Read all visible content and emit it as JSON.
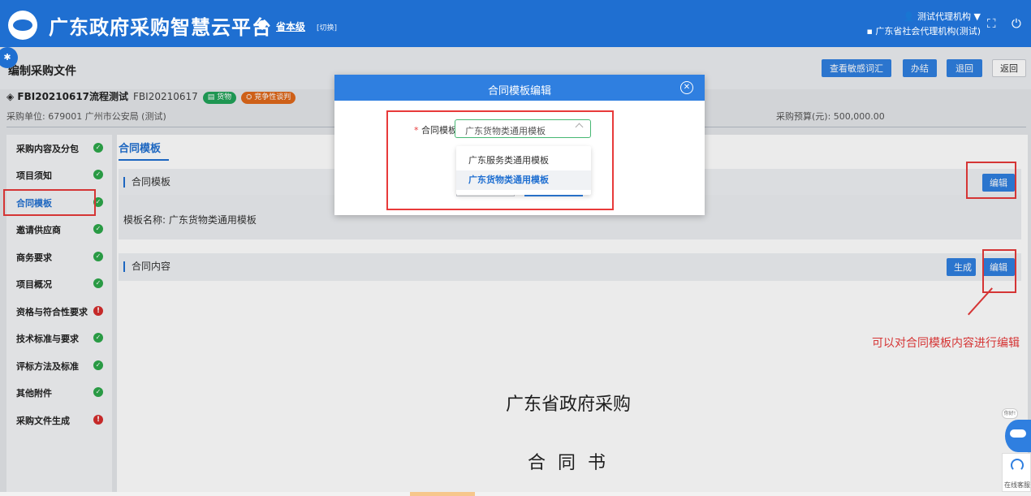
{
  "header": {
    "app_title": "广东政府采购智慧云平台",
    "region": "省本级",
    "switch_label": "[切换]",
    "user_name": "测试代理机构",
    "org_name": "广东省社会代理机构(测试)"
  },
  "toolbar": {
    "page_title": "编制采购文件",
    "sensitive_words": "查看敏感词汇",
    "finish": "办结",
    "return_back": "退回",
    "back": "返回"
  },
  "project": {
    "name": "FBI20210617流程测试",
    "code": "FBI20210617",
    "tag_goods": "▤ 货物",
    "tag_method": "⛭ 竞争性谈判",
    "purchaser": "采购单位: 679001 广州市公安局 (测试)",
    "budget": "采购预算(元): 500,000.00"
  },
  "sidebar": {
    "items": [
      {
        "label": "采购内容及分包",
        "status": "ok"
      },
      {
        "label": "项目须知",
        "status": "ok"
      },
      {
        "label": "合同模板",
        "status": "ok"
      },
      {
        "label": "邀请供应商",
        "status": "ok"
      },
      {
        "label": "商务要求",
        "status": "ok"
      },
      {
        "label": "项目概况",
        "status": "ok"
      },
      {
        "label": "资格与符合性要求",
        "status": "warn"
      },
      {
        "label": "技术标准与要求",
        "status": "ok"
      },
      {
        "label": "评标方法及标准",
        "status": "ok"
      },
      {
        "label": "其他附件",
        "status": "ok"
      },
      {
        "label": "采购文件生成",
        "status": "warn"
      }
    ]
  },
  "main": {
    "tab": "合同模板",
    "section_template": "合同模板",
    "edit_label": "编辑",
    "template_name": "模板名称: 广东货物类通用模板",
    "section_content": "合同内容",
    "generate_label": "生成",
    "doc_title": "广东省政府采购",
    "doc_subtitle": "合 同 书"
  },
  "annotation": "可以对合同模板内容进行编辑",
  "modal": {
    "title": "合同模板编辑",
    "close_glyph": "✕",
    "field_required": "*",
    "field_label": "合同模板",
    "selected_value": "广东货物类通用模板",
    "options": [
      "广东服务类通用模板",
      "广东货物类通用模板"
    ]
  },
  "widgets": {
    "bubble": "你好!",
    "service_label": "在线客服"
  },
  "colors": {
    "brand": "#1f6fd1",
    "accent": "#2f7fe0",
    "success": "#2da84a",
    "danger": "#d62d2d",
    "annotation": "#e83a3a"
  }
}
